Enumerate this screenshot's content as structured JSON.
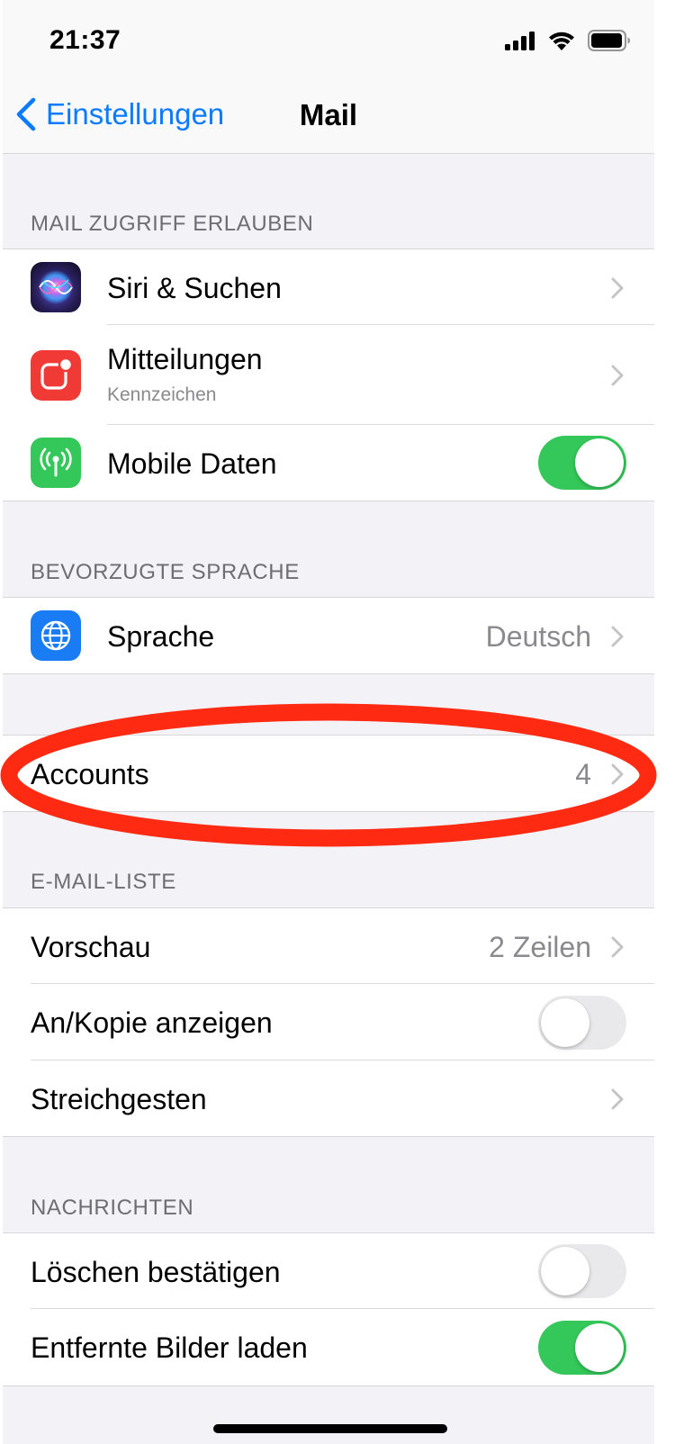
{
  "status_bar": {
    "time": "21:37"
  },
  "nav": {
    "back_label": "Einstellungen",
    "title": "Mail"
  },
  "sections": {
    "access_header": "MAIL ZUGRIFF ERLAUBEN",
    "language_header": "BEVORZUGTE SPRACHE",
    "mail_list_header": "E-MAIL-LISTE",
    "messages_header": "NACHRICHTEN"
  },
  "access": {
    "siri": {
      "label": "Siri & Suchen",
      "icon": "siri-icon"
    },
    "notifications": {
      "label": "Mitteilungen",
      "sub": "Kennzeichen",
      "icon": "notifications-icon"
    },
    "mobile_data": {
      "label": "Mobile Daten",
      "icon": "antenna-icon",
      "on": true
    }
  },
  "language": {
    "label": "Sprache",
    "value": "Deutsch",
    "icon": "globe-icon"
  },
  "accounts": {
    "label": "Accounts",
    "value": "4",
    "highlighted": true
  },
  "mail_list": {
    "preview": {
      "label": "Vorschau",
      "value": "2 Zeilen"
    },
    "show_to_cc": {
      "label": "An/Kopie anzeigen",
      "on": false
    },
    "swipe": {
      "label": "Streichgesten"
    }
  },
  "messages": {
    "confirm_delete": {
      "label": "Löschen bestätigen",
      "on": false
    },
    "load_remote_images": {
      "label": "Entfernte Bilder laden",
      "on": true
    }
  },
  "colors": {
    "accent": "#0a7aff",
    "toggle_on": "#34c759",
    "highlight": "#ff2a12",
    "notifications_icon": "#f03a36",
    "mobile_data_icon": "#34c759",
    "language_icon": "#1a7cf5"
  }
}
